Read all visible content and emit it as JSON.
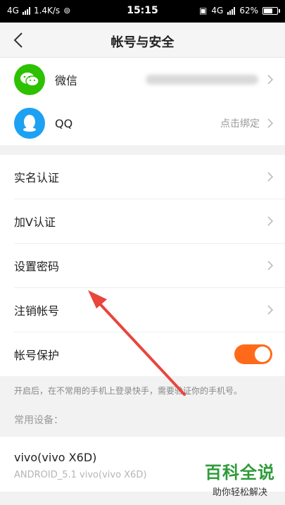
{
  "status_bar": {
    "network": "4G",
    "speed": "1.4K/s",
    "time": "15:15",
    "network_right": "4G",
    "battery": "62%"
  },
  "nav": {
    "title": "帐号与安全"
  },
  "social": {
    "wechat": {
      "label": "微信"
    },
    "qq": {
      "label": "QQ",
      "value": "点击绑定"
    }
  },
  "menu": {
    "realname": "实名认证",
    "verify_v": "加V认证",
    "set_password": "设置密码",
    "cancel_account": "注销帐号",
    "protect": "帐号保护"
  },
  "protect_on": true,
  "hint": "开启后，在不常用的手机上登录快手，需要验证你的手机号。",
  "devices_header": "常用设备：",
  "device": {
    "name": "vivo(vivo X6D)",
    "sub": "ANDROID_5.1 vivo(vivo X6D)"
  },
  "watermark": {
    "title": "百科全说",
    "subtitle": "助你轻松解决"
  },
  "colors": {
    "accent": "#ff6a1a",
    "wechat": "#2dc100",
    "qq": "#1da1f2",
    "arrow": "#e8463c"
  }
}
